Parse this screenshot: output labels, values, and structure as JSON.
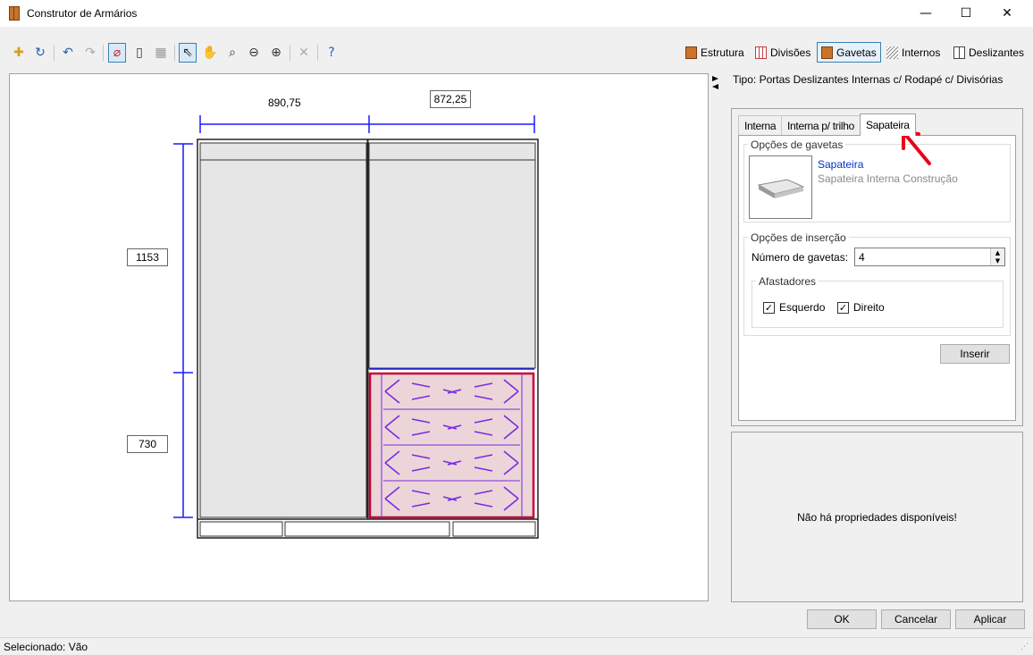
{
  "window": {
    "title": "Construtor de Armários",
    "minimize": "—",
    "maximize": "☐",
    "close": "✕"
  },
  "toolbar": {
    "tabs": [
      {
        "label": "Estrutura",
        "icon": "estrutura-icon"
      },
      {
        "label": "Divisões",
        "icon": "divisoes-icon"
      },
      {
        "label": "Gavetas",
        "icon": "gavetas-icon",
        "selected": true
      },
      {
        "label": "Internos",
        "icon": "internos-icon"
      },
      {
        "label": "Deslizantes",
        "icon": "deslizantes-icon"
      }
    ]
  },
  "canvas": {
    "dim_top_left": "890,75",
    "dim_top_right": "872,25",
    "dim_left_upper": "1153",
    "dim_left_lower": "730"
  },
  "panel": {
    "tipo": "Tipo: Portas Deslizantes Internas c/ Rodapé c/ Divisórias",
    "tabs": [
      "Interna",
      "Interna p/ trilho",
      "Sapateira"
    ],
    "active_tab": "Sapateira",
    "group_gavetas": "Opções de gavetas",
    "item_name": "Sapateira",
    "item_desc": "Sapateira Interna Construção",
    "group_insercao": "Opções de inserção",
    "num_label": "Número de gavetas:",
    "num_value": "4",
    "group_afastadores": "Afastadores",
    "chk_esquerdo": "Esquerdo",
    "chk_direito": "Direito",
    "chk_esquerdo_checked": true,
    "chk_direito_checked": true,
    "insert_button": "Inserir",
    "no_props": "Não há propriedades disponíveis!"
  },
  "footer": {
    "ok": "OK",
    "cancel": "Cancelar",
    "apply": "Aplicar"
  },
  "status": "Selecionado: Vão",
  "colors": {
    "dimension_line": "#1a1aff",
    "selection": "#cc0033",
    "drawer_fill": "#ecd5d8",
    "drawer_lines": "#7a2be0",
    "panel_fill": "#e6e6e6",
    "annotation_arrow": "#e8001c"
  }
}
